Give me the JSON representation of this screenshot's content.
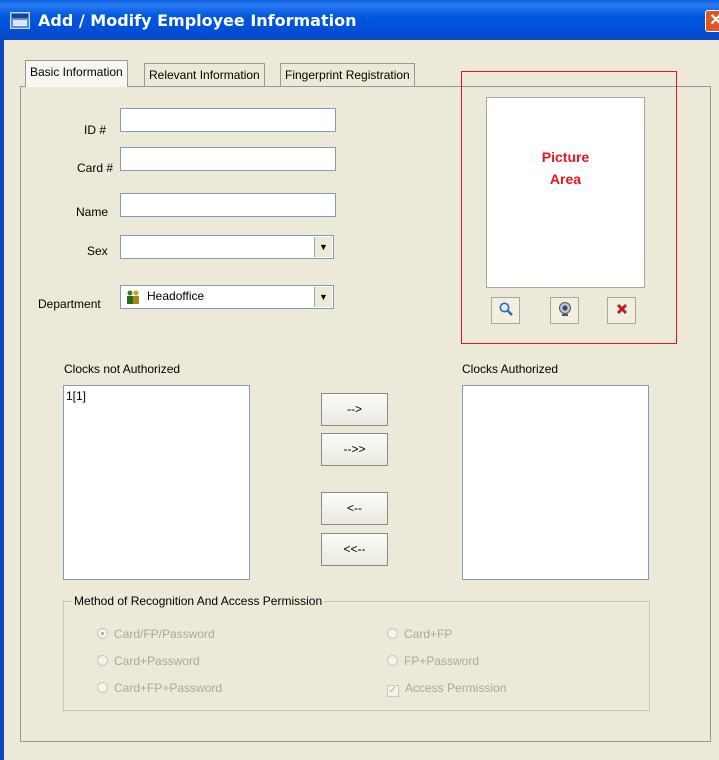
{
  "window": {
    "title": "Add / Modify Employee Information",
    "close_glyph": "✕"
  },
  "tabs": [
    {
      "label": "Basic Information",
      "active": true
    },
    {
      "label": "Relevant Information",
      "active": false
    },
    {
      "label": "Fingerprint Registration",
      "active": false
    }
  ],
  "form": {
    "id_label": "ID #",
    "id_value": "",
    "card_label": "Card #",
    "card_value": "",
    "name_label": "Name",
    "name_value": "",
    "sex_label": "Sex",
    "sex_value": "",
    "department_label": "Department",
    "department_value": "Headoffice"
  },
  "picture": {
    "label_line1": "Picture",
    "label_line2": "Area",
    "buttons": [
      {
        "icon": "magnifier-icon"
      },
      {
        "icon": "webcam-icon"
      },
      {
        "icon": "delete-icon"
      }
    ],
    "frame_color": "#e8141a"
  },
  "clocks": {
    "not_authorized_label": "Clocks not Authorized",
    "not_authorized_items": [
      "1[1]"
    ],
    "authorized_label": "Clocks Authorized",
    "authorized_items": [],
    "buttons": [
      "-->",
      "-->>",
      "<--",
      "<<--"
    ]
  },
  "recognition": {
    "title": "Method of Recognition And Access Permission",
    "options": [
      {
        "label": "Card/FP/Password",
        "type": "radio",
        "checked": true
      },
      {
        "label": "Card+FP",
        "type": "radio",
        "checked": false
      },
      {
        "label": "Card+Password",
        "type": "radio",
        "checked": false
      },
      {
        "label": "FP+Password",
        "type": "radio",
        "checked": false
      },
      {
        "label": "Card+FP+Password",
        "type": "radio",
        "checked": false
      },
      {
        "label": "Access Permission",
        "type": "checkbox",
        "checked": true
      }
    ]
  }
}
